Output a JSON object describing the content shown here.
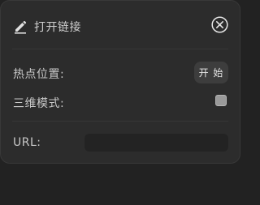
{
  "header": {
    "icon": "pencil-icon",
    "title": "打开链接",
    "close_icon": "close-circle-icon"
  },
  "rows": {
    "hotspot_label": "热点位置:",
    "start_button_label": "开 始",
    "mode_3d_label": "三维模式:",
    "mode_3d_checked": false,
    "url_label": "URL:",
    "url_value": ""
  },
  "colors": {
    "panel_bg": "#2c2c2c",
    "page_bg": "#222222",
    "text": "#c8c8c8",
    "button_bg": "#3d3d3d",
    "input_bg": "#232323"
  }
}
